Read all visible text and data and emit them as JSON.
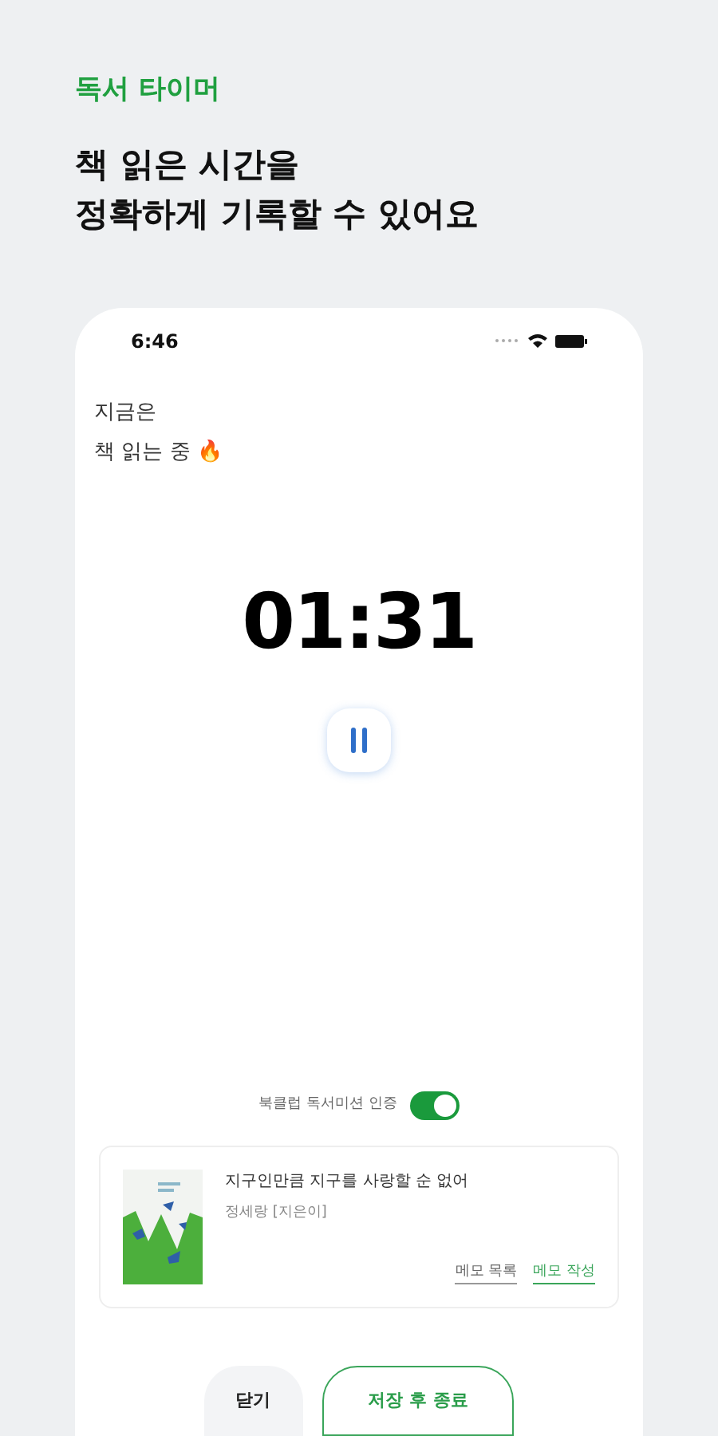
{
  "header": {
    "label": "독서 타이머",
    "headline": "책 읽은 시간을\n정확하게 기록할 수 있어요"
  },
  "status_bar": {
    "time": "6:46"
  },
  "status": {
    "line_1": "지금은",
    "line_2": "책 읽는 중 🔥"
  },
  "timer": {
    "time": "01:31",
    "paused": false
  },
  "mission": {
    "label": "북클럽 독서미션 인증",
    "on": true
  },
  "book": {
    "title": "지구인만큼 지구를 사랑할 순 없어",
    "author": "정세랑 [지은이]",
    "links": [
      {
        "label": "메모 목록",
        "kind": "plain"
      },
      {
        "label": "메모 작성",
        "kind": "accent"
      }
    ]
  },
  "buttons": [
    {
      "label": "닫기",
      "kind": "secondary"
    },
    {
      "label": "저장 후 종료",
      "kind": "primary"
    }
  ]
}
